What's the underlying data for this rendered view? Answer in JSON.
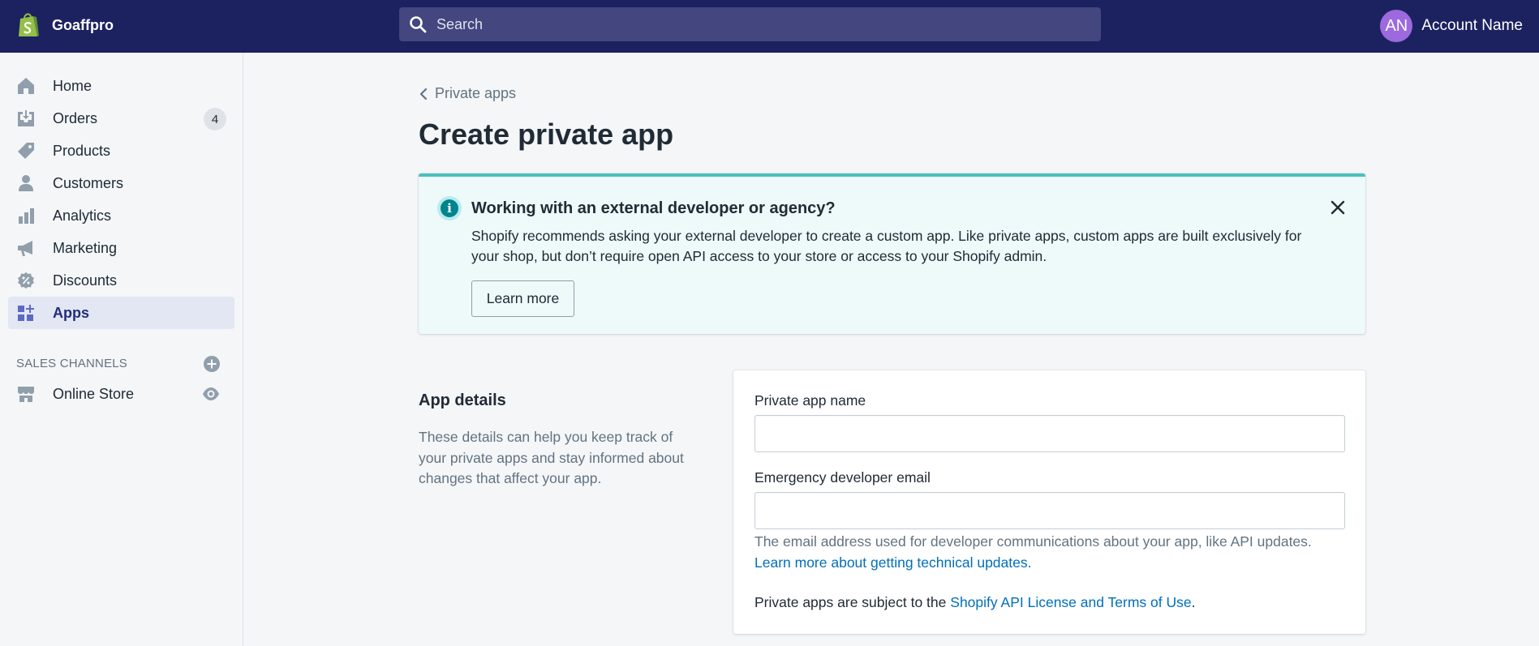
{
  "topbar": {
    "store_name": "Goaffpro",
    "search_placeholder": "Search",
    "avatar_initials": "AN",
    "account_name": "Account Name"
  },
  "sidebar": {
    "items": [
      {
        "label": "Home",
        "icon": "home-icon"
      },
      {
        "label": "Orders",
        "icon": "orders-icon",
        "badge": "4"
      },
      {
        "label": "Products",
        "icon": "tag-icon"
      },
      {
        "label": "Customers",
        "icon": "person-icon"
      },
      {
        "label": "Analytics",
        "icon": "bar-chart-icon"
      },
      {
        "label": "Marketing",
        "icon": "megaphone-icon"
      },
      {
        "label": "Discounts",
        "icon": "discount-icon"
      },
      {
        "label": "Apps",
        "icon": "apps-icon",
        "active": true
      }
    ],
    "sales_channels_heading": "SALES CHANNELS",
    "online_store_label": "Online Store"
  },
  "main": {
    "breadcrumb": "Private apps",
    "title": "Create private app",
    "banner": {
      "title": "Working with an external developer or agency?",
      "body": "Shopify recommends asking your external developer to create a custom app. Like private apps, custom apps are built exclusively for your shop, but don’t require open API access to your store or access to your Shopify admin.",
      "button_label": "Learn more"
    },
    "app_details": {
      "title": "App details",
      "description": "These details can help you keep track of your private apps and stay informed about changes that affect your app.",
      "name_label": "Private app name",
      "name_value": "",
      "email_label": "Emergency developer email",
      "email_value": "",
      "help_text": "The email address used for developer communications about your app, like API updates.",
      "help_link": "Learn more about getting technical updates.",
      "terms_prefix": "Private apps are subject to the",
      "terms_link": "Shopify API License and Terms of Use",
      "terms_suffix": "."
    }
  },
  "colors": {
    "topbar": "#1c2260",
    "search": "#43467f",
    "avatar": "#9c6ade",
    "active_nav": "#e3e6f3",
    "banner_bg": "#eef9f9",
    "banner_border": "#47c1bf",
    "link": "#006fbb"
  }
}
